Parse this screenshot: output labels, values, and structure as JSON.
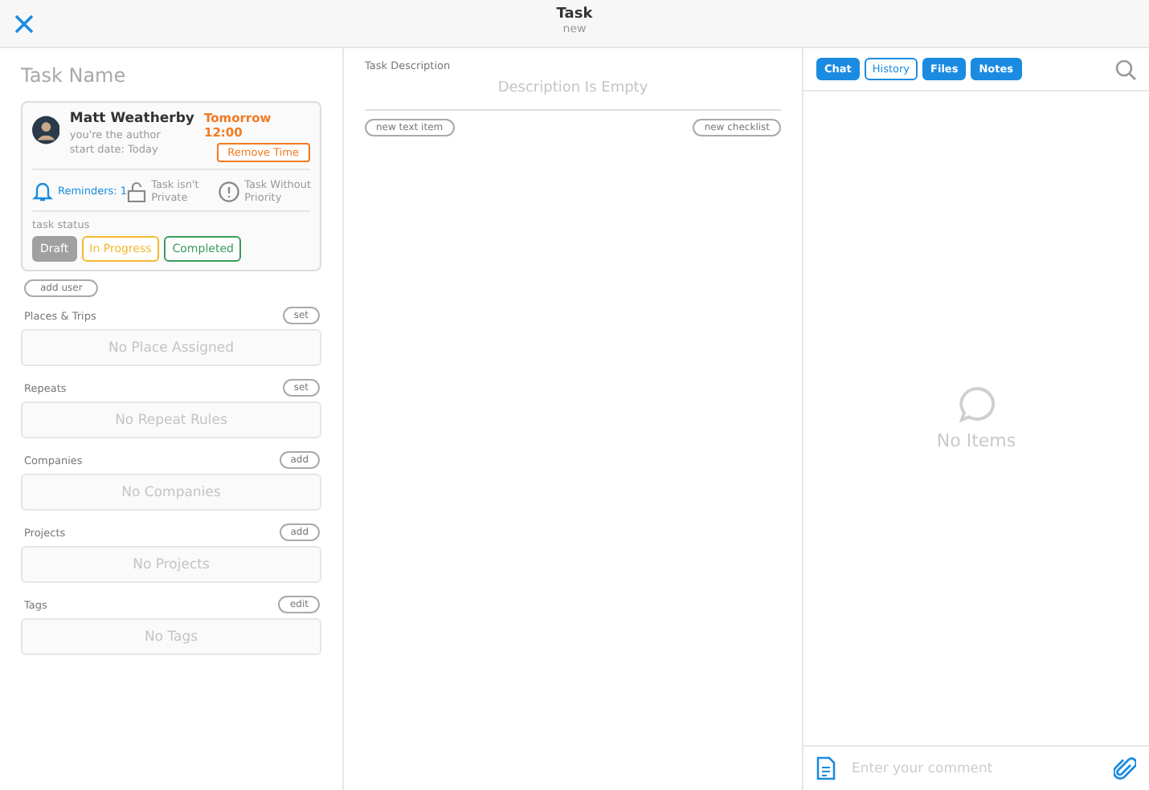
{
  "header": {
    "title": "Task",
    "subtitle": "new"
  },
  "task": {
    "name_placeholder": "Task Name",
    "user": {
      "name": "Matt Weatherby",
      "role": "you're the author",
      "start": "start date: Today"
    },
    "due": "Tomorrow 12:00",
    "remove_time": "Remove Time",
    "reminders": "Reminders: 1",
    "privacy": "Task isn't Private",
    "priority": "Task Without Priority",
    "status_label": "task status",
    "statuses": [
      {
        "label": "Draft",
        "selected": true,
        "color": "#a0a0a0"
      },
      {
        "label": "In Progress",
        "selected": false,
        "color": "#f5b82e"
      },
      {
        "label": "Completed",
        "selected": false,
        "color": "#3a9a5c"
      }
    ],
    "add_user": "add user"
  },
  "sections": [
    {
      "label": "Places & Trips",
      "action": "set",
      "empty": "No Place Assigned"
    },
    {
      "label": "Repeats",
      "action": "set",
      "empty": "No Repeat Rules"
    },
    {
      "label": "Companies",
      "action": "add",
      "empty": "No Companies"
    },
    {
      "label": "Projects",
      "action": "add",
      "empty": "No Projects"
    },
    {
      "label": "Tags",
      "action": "edit",
      "empty": "No Tags"
    }
  ],
  "description": {
    "label": "Task Description",
    "empty": "Description Is Empty",
    "buttons": [
      "new text item",
      "new checklist"
    ]
  },
  "tabs": [
    {
      "label": "Chat",
      "selected": false
    },
    {
      "label": "History",
      "selected": true
    },
    {
      "label": "Files",
      "selected": false
    },
    {
      "label": "Notes",
      "selected": false
    }
  ],
  "chat": {
    "empty": "No Items",
    "placeholder": "Enter your comment"
  }
}
